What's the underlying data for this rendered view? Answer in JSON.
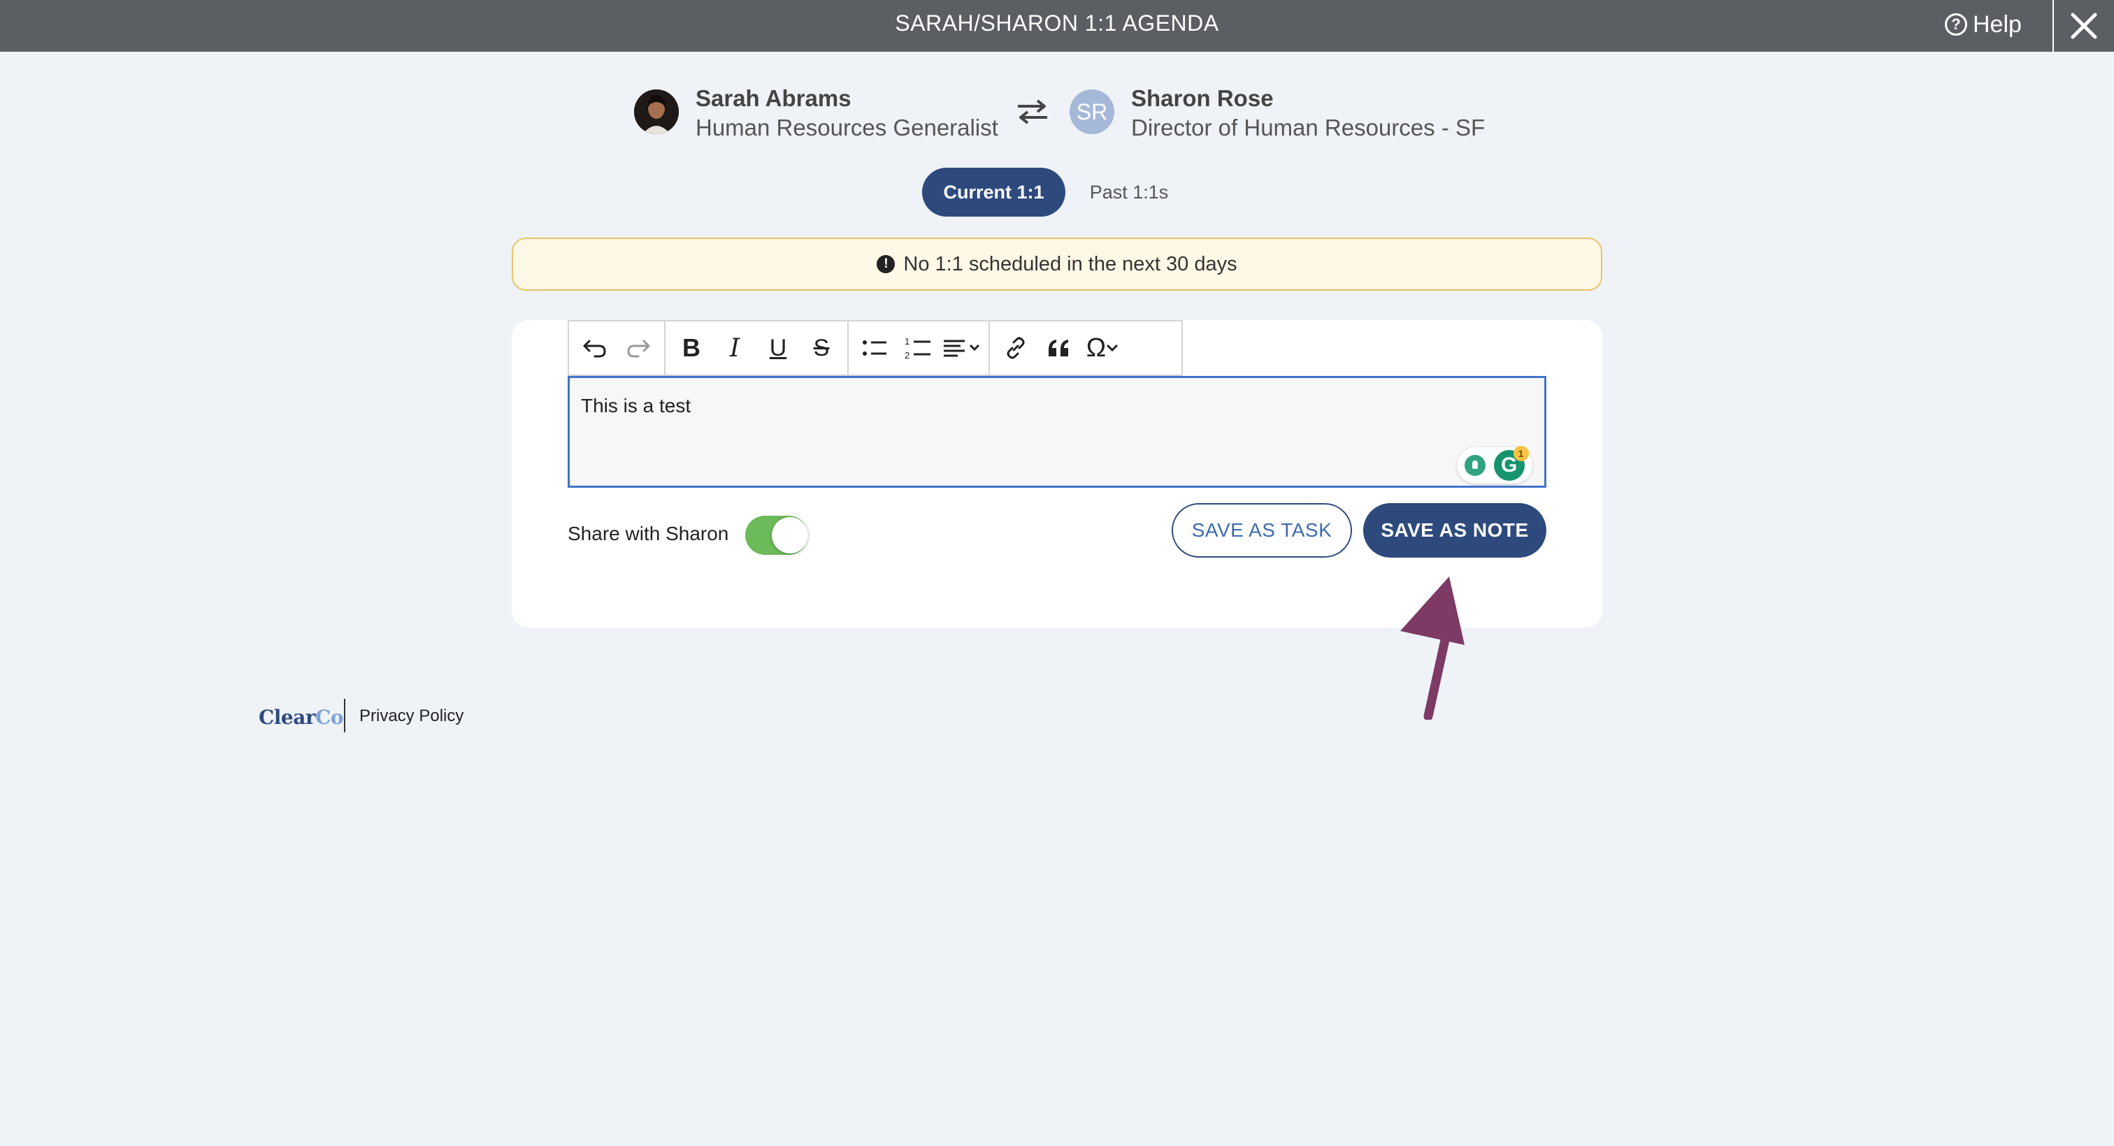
{
  "header": {
    "title": "SARAH/SHARON 1:1 AGENDA",
    "help_label": "Help"
  },
  "participants": {
    "self": {
      "name": "Sarah Abrams",
      "role": "Human Resources Generalist"
    },
    "other": {
      "name": "Sharon Rose",
      "role": "Director of Human Resources - SF",
      "initials": "SR"
    }
  },
  "tabs": [
    {
      "label": "Current 1:1",
      "active": true
    },
    {
      "label": "Past 1:1s",
      "active": false
    }
  ],
  "alert": {
    "text": "No 1:1 scheduled in the next 30 days",
    "icon": "!"
  },
  "editor": {
    "content": "This is a test",
    "toolbar_icons": [
      "undo-icon",
      "redo-icon",
      "bold-icon",
      "italic-icon",
      "underline-icon",
      "strikethrough-icon",
      "bullet-list-icon",
      "numbered-list-icon",
      "align-icon",
      "link-icon",
      "blockquote-icon",
      "special-character-icon"
    ],
    "grammarly_badge_count": "1"
  },
  "share": {
    "label": "Share with Sharon",
    "enabled": true
  },
  "actions": {
    "save_task": "SAVE AS TASK",
    "save_note": "SAVE AS NOTE"
  },
  "footer": {
    "logo_main": "Clear",
    "logo_accent": "Co",
    "privacy": "Privacy Policy"
  },
  "colors": {
    "primary": "#2e4a7d",
    "topbar": "#5b5e62",
    "toggle_on": "#6dba5a",
    "alert_bg": "#fff8e6",
    "arrow": "#7d3a64"
  }
}
